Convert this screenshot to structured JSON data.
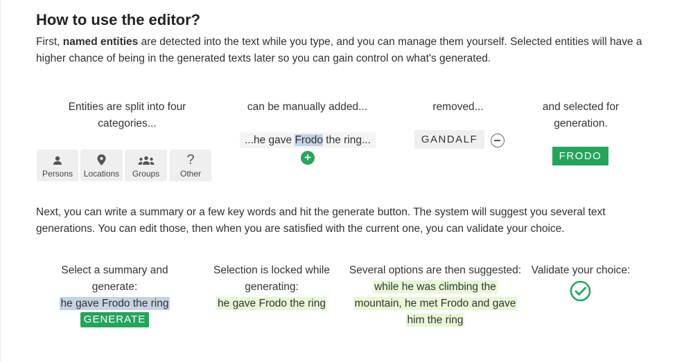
{
  "heading": "How to use the editor?",
  "intro": {
    "prefix": "First,",
    "bold": "named entities",
    "rest": " are detected into the text while you type, and you can manage them yourself. Selected entities will have a higher chance of being in the generated texts later so you can gain control on what's generated."
  },
  "step1": {
    "col1": "Entities are split into four categories...",
    "col2": "can be manually added...",
    "col3": "removed...",
    "col4": "and selected for generation.",
    "categories": [
      {
        "label": "Persons",
        "icon": "person-icon"
      },
      {
        "label": "Locations",
        "icon": "location-pin-icon"
      },
      {
        "label": "Groups",
        "icon": "group-icon"
      },
      {
        "label": "Other",
        "icon": "question-mark-icon"
      }
    ],
    "sample_before": "...he gave ",
    "sample_entity": "Frodo",
    "sample_after": " the ring...",
    "removed_entity": "GANDALF",
    "selected_entity": "FRODO"
  },
  "next_paragraph": "Next, you can write a summary or a few key words and hit the generate button. The system will suggest you several text generations. You can edit those, then when you are satisfied with the current one, you can validate your choice.",
  "step2": {
    "col1": "Select a summary and generate:",
    "col1_selection": "he gave Frodo the ring",
    "generate_button": "GENERATE",
    "col2": "Selection is locked while generating:",
    "col2_selection": "he gave Frodo the ring",
    "col3": "Several options are then suggested:",
    "col3_option": "while he was climbing the mountain, he met Frodo and gave him the ring",
    "col4": "Validate your choice:"
  },
  "colors": {
    "accent_green": "#25a45c",
    "selection_blue": "#c5d3e2",
    "locked_green": "#e8f7d6"
  }
}
